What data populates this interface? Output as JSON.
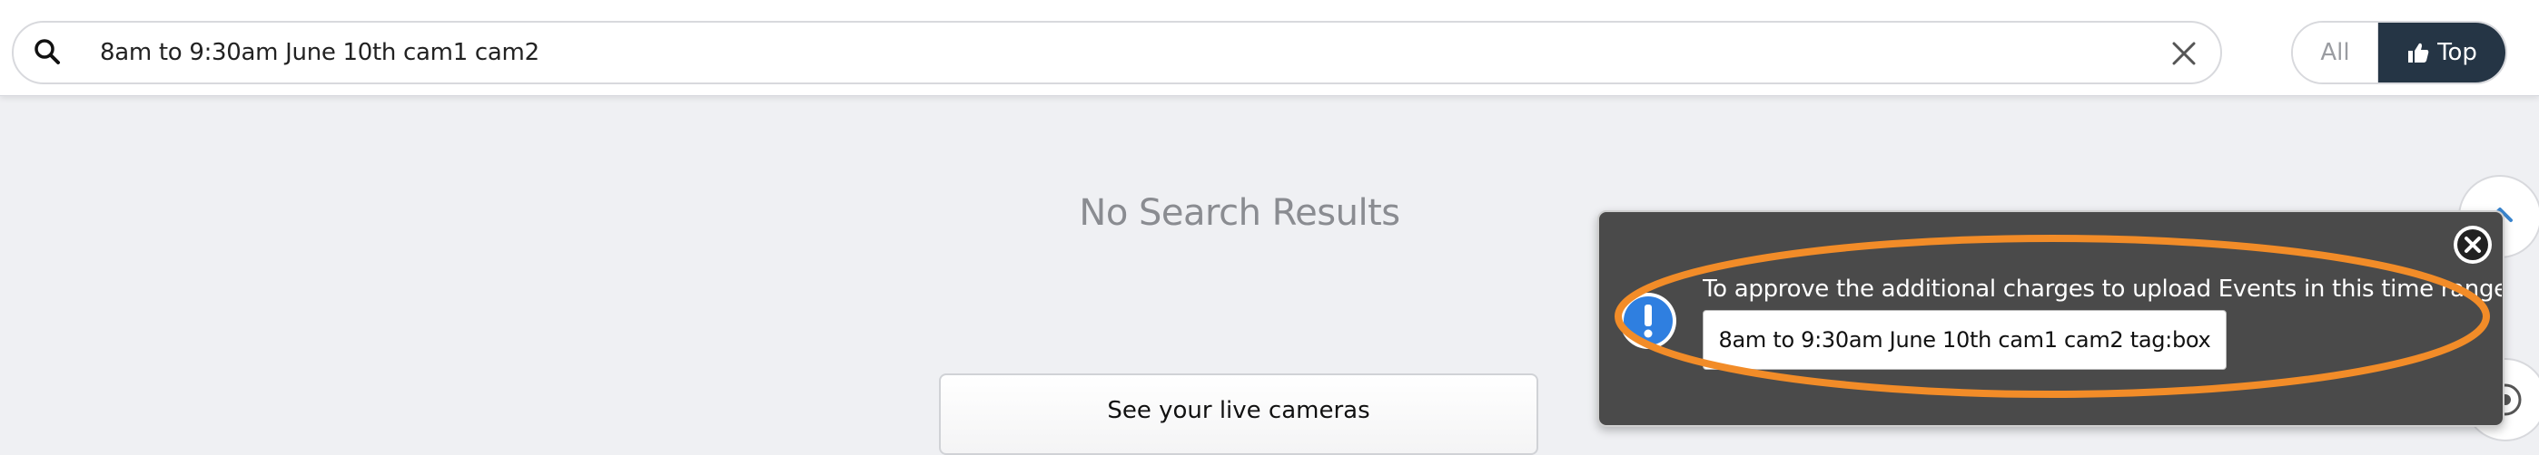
{
  "search": {
    "value": "8am to 9:30am June 10th cam1 cam2",
    "placeholder": ""
  },
  "filter": {
    "all_label": "All",
    "top_label": "Top",
    "selected": "Top"
  },
  "main": {
    "no_results_text": "No Search Results",
    "live_cameras_button": "See your live cameras"
  },
  "toast": {
    "message": "To approve the additional charges to upload Events in this time range, click",
    "action_button": "8am to 9:30am June 10th cam1 cam2 tag:box"
  },
  "icons": {
    "search": "search-icon",
    "clear": "close-icon",
    "thumbs_up": "thumbs-up-icon",
    "info": "info-icon",
    "toast_close": "close-circle-icon",
    "scroll_up": "chevron-up-icon"
  },
  "colors": {
    "top_active_bg": "#253545",
    "toast_bg": "#4a4a4a",
    "info_blue": "#2f7fe0",
    "highlight_orange": "#f28c28",
    "chevron_blue": "#3a86d0"
  }
}
